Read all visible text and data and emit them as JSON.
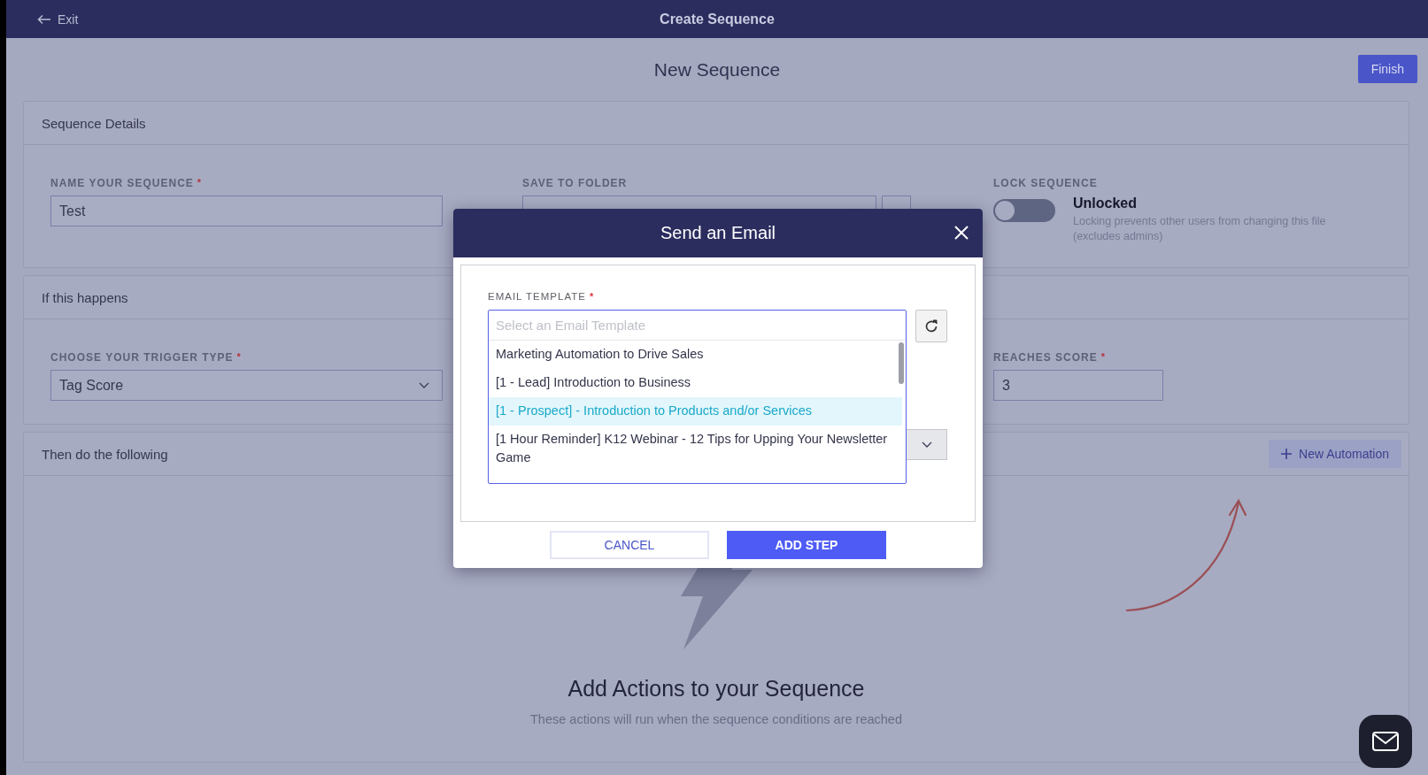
{
  "top_bar": {
    "exit": "Exit",
    "title": "Create Sequence"
  },
  "header": {
    "title": "New Sequence",
    "finish": "Finish"
  },
  "sequence_details": {
    "title": "Sequence Details",
    "name_field": {
      "label": "NAME YOUR SEQUENCE",
      "required_mark": "*",
      "value": "Test"
    },
    "folder_field": {
      "label": "SAVE TO FOLDER"
    },
    "lock": {
      "label": "LOCK SEQUENCE",
      "on": false,
      "state": "Unlocked",
      "hint": "Locking prevents other users from changing this file (excludes admins)"
    }
  },
  "trigger": {
    "title": "If this happens",
    "trigger_field": {
      "label": "CHOOSE YOUR TRIGGER TYPE",
      "required_mark": "*",
      "value": "Tag Score"
    },
    "score_field": {
      "label": "REACHES SCORE",
      "required_mark": "*",
      "value": "3"
    }
  },
  "actions": {
    "title": "Then do the following",
    "new_automation": "New Automation",
    "empty_title": "Add Actions to your Sequence",
    "empty_text": "These actions will run when the sequence conditions are reached"
  },
  "modal": {
    "title": "Send an Email",
    "field_label": "EMAIL TEMPLATE",
    "required_mark": "*",
    "placeholder": "Select an Email Template",
    "options": [
      {
        "label": "Marketing Automation to Drive Sales",
        "selected": false
      },
      {
        "label": "[1 - Lead] Introduction to Business",
        "selected": false
      },
      {
        "label": "[1 - Prospect] - Introduction to Products and/or Services",
        "selected": true
      },
      {
        "label": "[1 Hour Reminder] K12 Webinar - 12 Tips for Upping Your Newsletter Game",
        "selected": false
      }
    ],
    "cancel": "CANCEL",
    "add_step": "ADD STEP"
  }
}
